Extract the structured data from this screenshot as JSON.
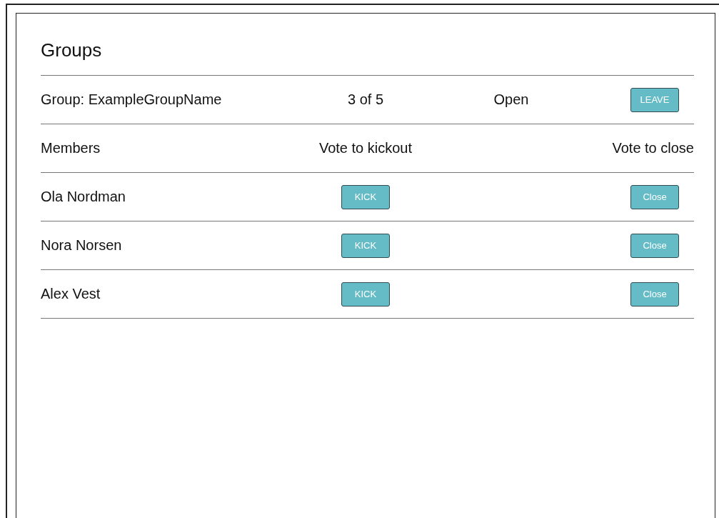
{
  "title": "Groups",
  "group": {
    "name": "Group: ExampleGroupName",
    "count": "3 of 5",
    "status": "Open",
    "leave_button": "LEAVE"
  },
  "columns": [
    "Members",
    "Vote to kickout",
    "Vote to close"
  ],
  "members": [
    {
      "name": "Ola Nordman",
      "kick_button": "KICK",
      "close_button": "Close"
    },
    {
      "name": "Nora Norsen",
      "kick_button": "KICK",
      "close_button": "Close"
    },
    {
      "name": "Alex Vest",
      "kick_button": "KICK",
      "close_button": "Close"
    }
  ]
}
